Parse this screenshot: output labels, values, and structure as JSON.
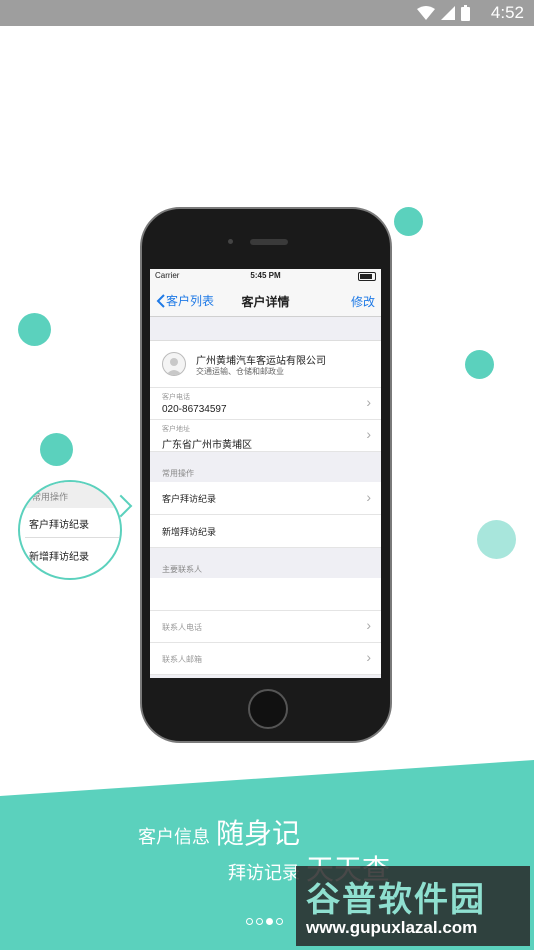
{
  "android_status": {
    "time": "4:52"
  },
  "colors": {
    "accent": "#5bd1bd",
    "ios_blue": "#1f7ae6",
    "statusbar": "#9e9e9e"
  },
  "phone_screen": {
    "carrier": "Carrier",
    "time": "5:45 PM",
    "nav": {
      "back_label": "客户列表",
      "title": "客户详情",
      "edit_label": "修改"
    },
    "company": {
      "name": "广州黄埔汽车客运站有限公司",
      "industry": "交通运输、仓储和邮政业"
    },
    "fields": [
      {
        "label": "客户电话",
        "value": "020-86734597"
      },
      {
        "label": "客户地址",
        "value": "广东省广州市黄埔区"
      }
    ],
    "common_ops": {
      "header": "常用操作",
      "items": [
        "客户拜访纪录",
        "新增拜访纪录"
      ]
    },
    "contacts": {
      "header": "主要联系人",
      "fields": [
        "联系人电话",
        "联系人邮箱"
      ]
    }
  },
  "zoom_bubble": {
    "header": "常用操作",
    "items": [
      "客户拜访纪录",
      "新增拜访纪录"
    ]
  },
  "slogan": {
    "line1_small": "客户信息",
    "line1_big": "随身记",
    "line2_small": "拜访记录",
    "line2_big": "天天查"
  },
  "pager": {
    "count": 4,
    "active_index": 2
  },
  "watermark": {
    "title": "谷普软件园",
    "url": "www.gupuxlazal.com"
  }
}
